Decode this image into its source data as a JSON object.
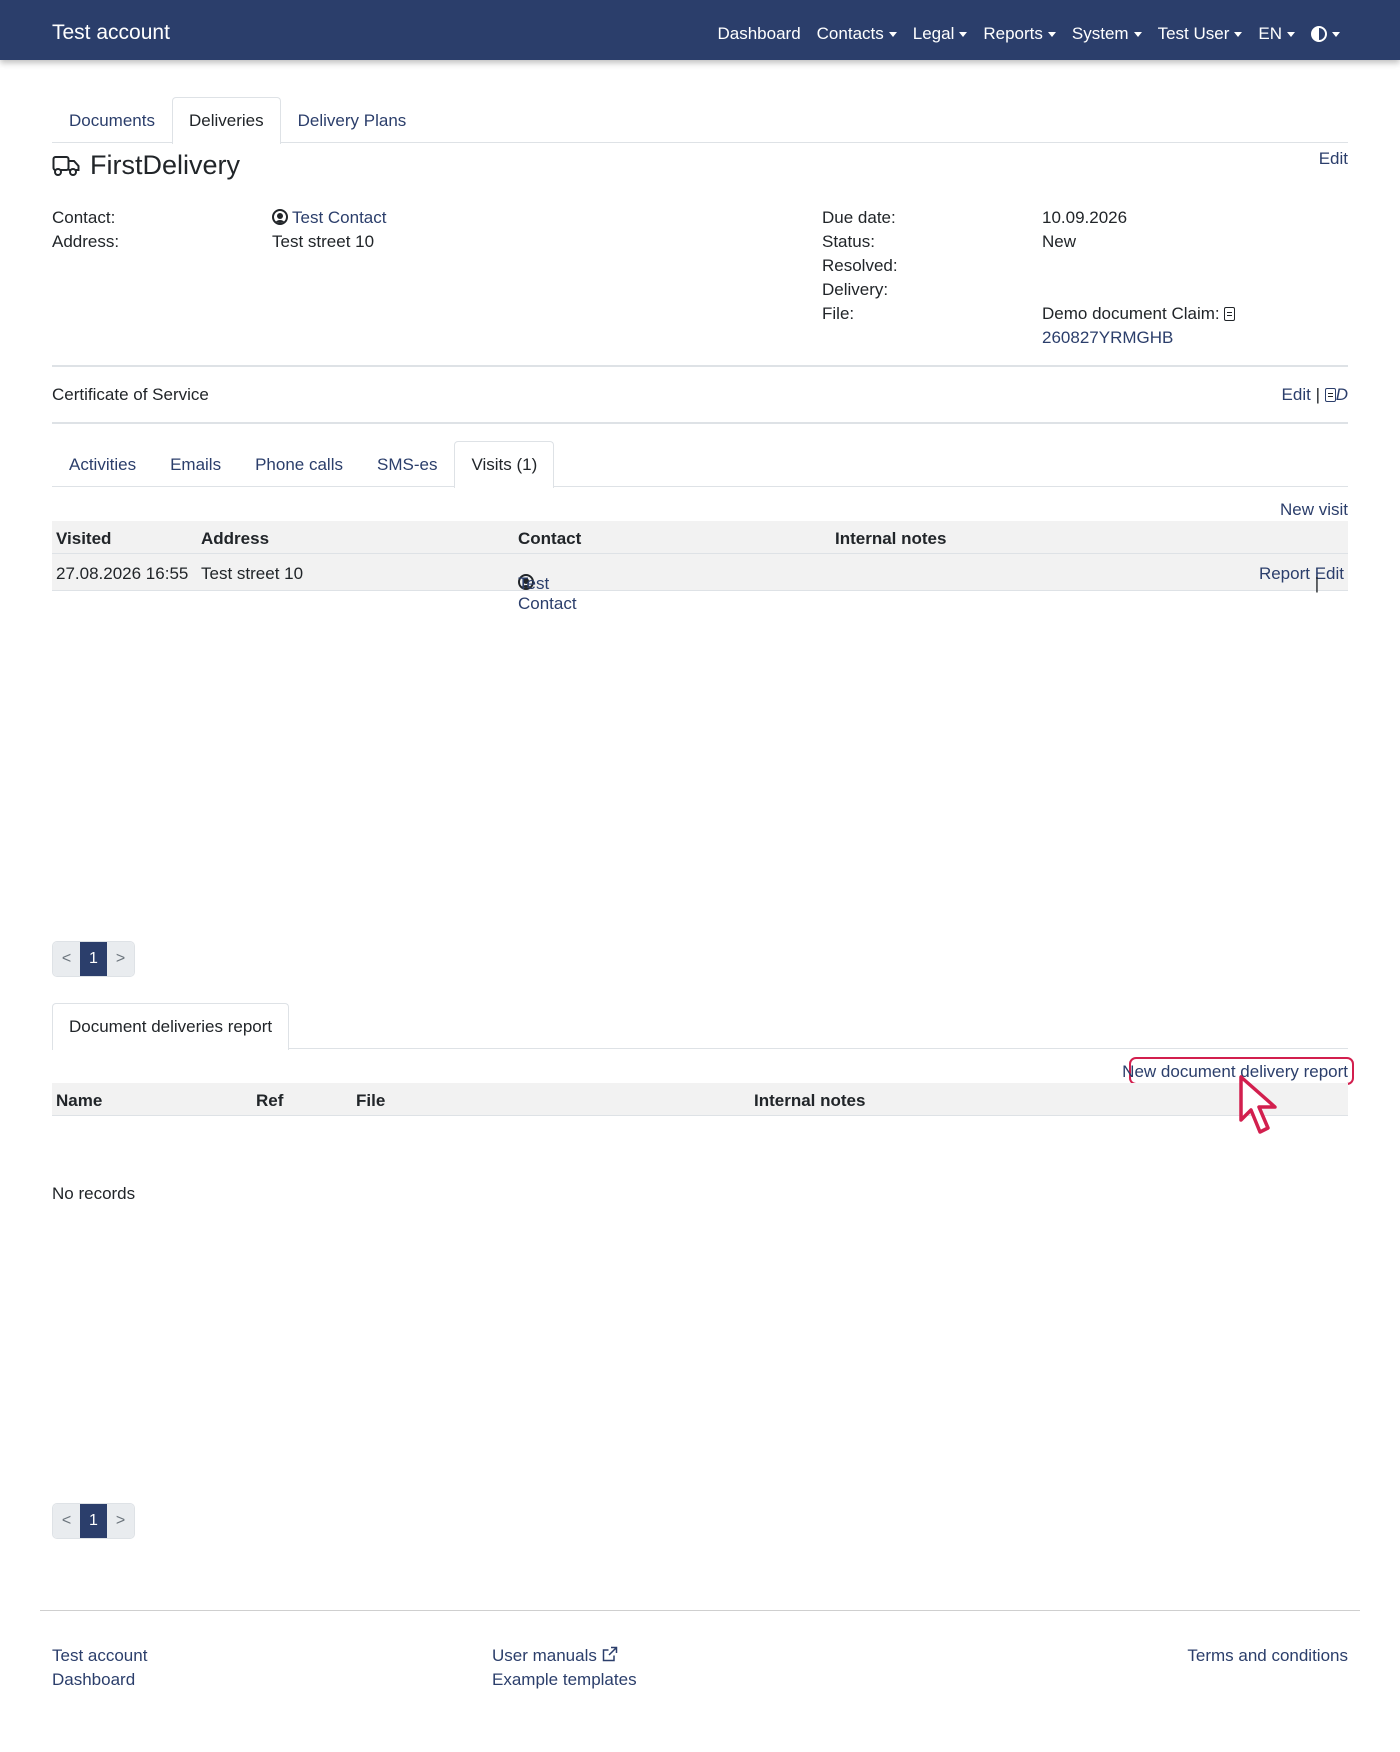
{
  "navbar": {
    "brand": "Test account",
    "items": [
      "Dashboard",
      "Contacts",
      "Legal",
      "Reports",
      "System",
      "Test User",
      "EN"
    ]
  },
  "top_tabs": [
    "Documents",
    "Deliveries",
    "Delivery Plans"
  ],
  "delivery": {
    "title": "FirstDelivery",
    "edit": "Edit",
    "contact_label": "Contact:",
    "contact_value": "Test Contact",
    "address_label": "Address:",
    "address_value": "Test street 10",
    "due_label": "Due date:",
    "due_value": "10.09.2026",
    "status_label": "Status:",
    "status_value": "New",
    "resolved_label": "Resolved:",
    "delivery_label": "Delivery:",
    "file_label": "File:",
    "file_value": "Demo document Claim:",
    "file_ref": "260827YRMGHB"
  },
  "certificate": {
    "label": "Certificate of Service",
    "edit": "Edit",
    "separator": "|",
    "doc_suffix": "D"
  },
  "sub_tabs": [
    "Activities",
    "Emails",
    "Phone calls",
    "SMS-es",
    "Visits (1)"
  ],
  "visits": {
    "new_link": "New visit",
    "headers": [
      "Visited",
      "Address",
      "Contact",
      "Internal notes"
    ],
    "rows": [
      {
        "visited": "27.08.2026 16:55",
        "address": "Test street 10",
        "contact": "Test Contact",
        "report": "Report",
        "separator": "|",
        "edit": "Edit"
      }
    ],
    "pager": {
      "prev": "<",
      "page": "1",
      "next": ">"
    }
  },
  "reports": {
    "tab": "Document deliveries report",
    "new_link": "New document delivery report",
    "headers": [
      "Name",
      "Ref",
      "File",
      "Internal notes"
    ],
    "empty": "No records",
    "pager": {
      "prev": "<",
      "page": "1",
      "next": ">"
    }
  },
  "footer": {
    "col1": [
      "Test account",
      "Dashboard"
    ],
    "col2": [
      "User manuals",
      "Example templates"
    ],
    "col3": "Terms and conditions"
  },
  "colors": {
    "navbar": "#2b3e6b",
    "link": "#2b3e6b",
    "highlight": "#d21f4e"
  }
}
